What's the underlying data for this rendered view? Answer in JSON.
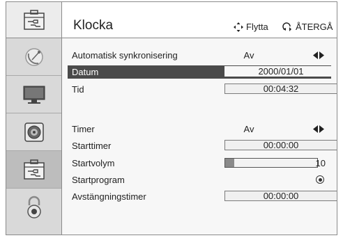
{
  "header": {
    "title": "Klocka",
    "move_hint": "Flytta",
    "back_hint": "ÅTERGÅ"
  },
  "sidebar": {
    "items": [
      {
        "icon": "toolbox-icon",
        "selected": false
      },
      {
        "icon": "satellite-dish-icon",
        "selected": false
      },
      {
        "icon": "monitor-icon",
        "selected": false
      },
      {
        "icon": "speaker-icon",
        "selected": false
      },
      {
        "icon": "toolbox-icon",
        "selected": true
      },
      {
        "icon": "lock-icon",
        "selected": false
      }
    ]
  },
  "settings": {
    "auto_sync": {
      "label": "Automatisk synkronisering",
      "value": "Av"
    },
    "date": {
      "label": "Datum",
      "value": "2000/01/01"
    },
    "time": {
      "label": "Tid",
      "value": "00:04:32"
    },
    "timer": {
      "label": "Timer",
      "value": "Av"
    },
    "start_timer": {
      "label": "Starttimer",
      "value": "00:00:00"
    },
    "start_volume": {
      "label": "Startvolym",
      "value": "10",
      "level_percent": 10
    },
    "start_program": {
      "label": "Startprogram"
    },
    "off_timer": {
      "label": "Avstängningstimer",
      "value": "00:00:00"
    }
  },
  "colors": {
    "highlight": "#4a4a4a",
    "sidebar_selected": "#bdbdbd"
  }
}
